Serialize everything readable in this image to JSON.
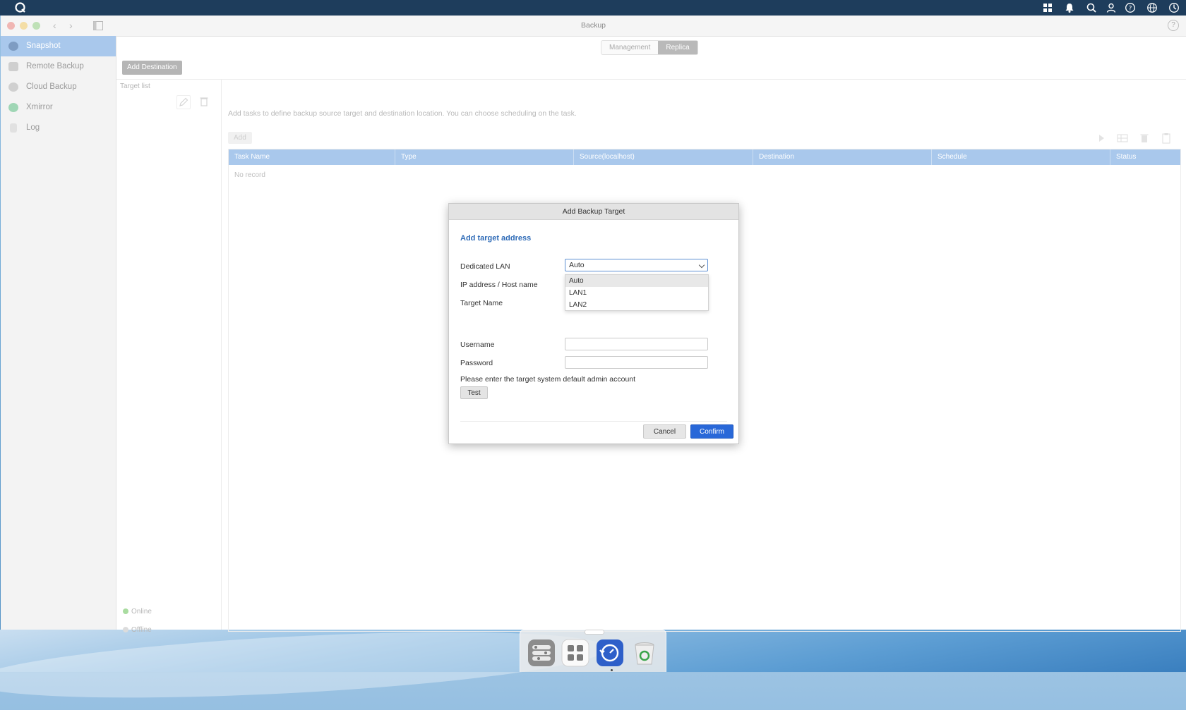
{
  "window": {
    "title": "Backup"
  },
  "sidebar": {
    "items": [
      {
        "label": "Snapshot",
        "icon": "snapshot-icon",
        "active": true
      },
      {
        "label": "Remote Backup",
        "icon": "remote-backup-icon"
      },
      {
        "label": "Cloud Backup",
        "icon": "cloud-backup-icon"
      },
      {
        "label": "Xmirror",
        "icon": "xmirror-icon"
      },
      {
        "label": "Log",
        "icon": "log-icon"
      }
    ]
  },
  "tabs": [
    {
      "label": "Management",
      "active": false
    },
    {
      "label": "Replica",
      "active": true
    }
  ],
  "toolbar": {
    "add_destination_label": "Add Destination"
  },
  "target_list": {
    "label": "Target list",
    "status": {
      "online": "Online",
      "offline": "Offline"
    }
  },
  "main": {
    "description": "Add tasks to define backup source target and destination location. You can choose scheduling on the task.",
    "add_label": "Add",
    "columns": [
      "Task Name",
      "Type",
      "Source(localhost)",
      "Destination",
      "Schedule",
      "Status"
    ],
    "empty_text": "No record"
  },
  "dialog": {
    "title": "Add Backup Target",
    "subtitle": "Add target address",
    "labels": {
      "dedicated_lan": "Dedicated LAN",
      "ip_host": "IP address / Host name",
      "target_name": "Target Name",
      "username": "Username",
      "password": "Password"
    },
    "dedicated_lan_value": "Auto",
    "lan_options": [
      "Auto",
      "LAN1",
      "LAN2"
    ],
    "note": "Please enter the target system default admin account",
    "test_label": "Test",
    "cancel_label": "Cancel",
    "confirm_label": "Confirm"
  },
  "colors": {
    "accent": "#2968d8",
    "header_blue": "#a9c8ec",
    "title_bar_dark": "#1e3d5c",
    "online": "#a9dca0",
    "offline": "#dcdcdc"
  }
}
